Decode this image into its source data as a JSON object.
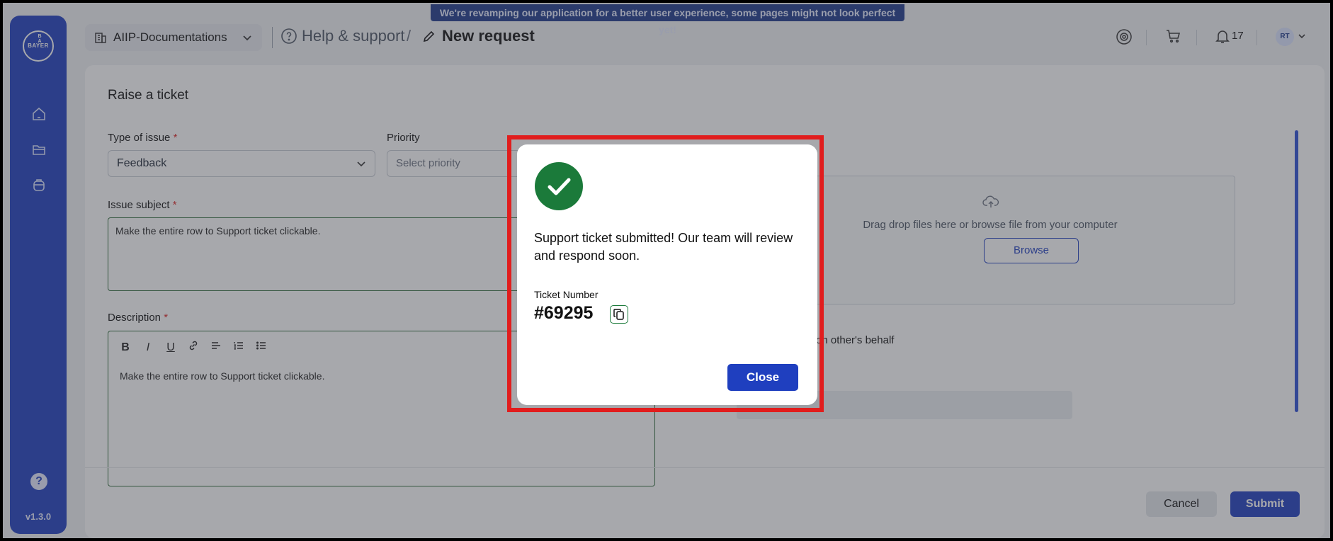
{
  "banner": {
    "text": "We're revamping our application for a better user experience, some pages might not look perfect yet!"
  },
  "sidebar": {
    "logo": "BAYER",
    "logo_vertical": [
      "B",
      "A",
      "Y",
      "E",
      "R"
    ],
    "items": [
      {
        "icon": "home-icon"
      },
      {
        "icon": "folder-icon"
      },
      {
        "icon": "box-icon"
      }
    ],
    "help_label": "?",
    "version": "v1.3.0"
  },
  "header": {
    "project": "AIIP-Documentations",
    "breadcrumb": {
      "parent": "Help & support",
      "separator": "/",
      "current": "New request"
    },
    "notifications_count": "17",
    "avatar_initials": "RT"
  },
  "form": {
    "title": "Raise a ticket",
    "type_of_issue": {
      "label": "Type of issue",
      "required_mark": "*",
      "value": "Feedback"
    },
    "priority": {
      "label": "Priority",
      "placeholder": "Select priority"
    },
    "issue_subject": {
      "label": "Issue subject",
      "required_mark": "*",
      "value": "Make the entire row to Support ticket clickable."
    },
    "description": {
      "label": "Description",
      "required_mark": "*",
      "toolbar": [
        "B",
        "I",
        "U"
      ],
      "value": "Make the entire row to Support ticket clickable."
    },
    "attachments": {
      "text": "Drag drop files here or browse file from your computer",
      "browse_label": "Browse"
    },
    "behalf_label": "on other's behalf",
    "cancel_label": "Cancel",
    "submit_label": "Submit"
  },
  "modal": {
    "message": "Support ticket submitted! Our team will review and respond soon.",
    "ticket_label": "Ticket Number",
    "ticket_number": "#69295",
    "close_label": "Close"
  },
  "colors": {
    "brand": "#1f3fbf",
    "success": "#1b7a3a",
    "highlight": "#e11d1d"
  }
}
